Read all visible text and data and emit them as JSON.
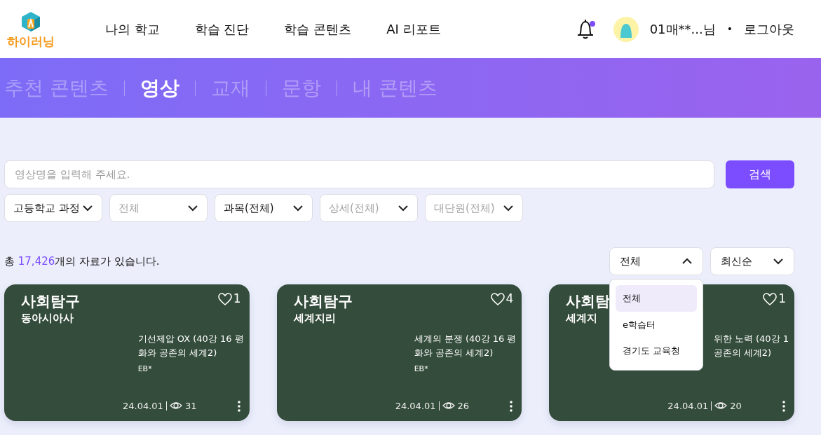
{
  "header": {
    "logo_text": "하이러닝",
    "nav": [
      "나의 학교",
      "학습 진단",
      "학습 콘텐츠",
      "AI 리포트"
    ],
    "has_notification": true,
    "user_name": "01매**...님",
    "user_separator": "•",
    "logout": "로그아웃"
  },
  "content_tabs": [
    {
      "label": "추천 콘텐츠",
      "selected": false
    },
    {
      "label": "영상",
      "selected": true
    },
    {
      "label": "교재",
      "selected": false
    },
    {
      "label": "문항",
      "selected": false
    },
    {
      "label": "내 콘텐츠",
      "selected": false
    }
  ],
  "search": {
    "placeholder": "영상명을 입력해 주세요.",
    "button": "검색"
  },
  "filters": [
    {
      "label": "고등학교 과정",
      "disabled": false
    },
    {
      "label": "전체",
      "disabled": true
    },
    {
      "label": "과목(전체)",
      "disabled": false
    },
    {
      "label": "상세(전체)",
      "disabled": true
    },
    {
      "label": "대단원(전체)",
      "disabled": true
    }
  ],
  "result": {
    "prefix": "총",
    "count": "17,426",
    "suffix": "개의 자료가 있습니다."
  },
  "sort_selects": [
    {
      "label": "전체",
      "expanded": true,
      "options": [
        {
          "label": "전체",
          "selected": true
        },
        {
          "label": "e학습터",
          "selected": false
        },
        {
          "label": "경기도 교육청",
          "selected": false
        }
      ]
    },
    {
      "label": "최신순",
      "expanded": false
    }
  ],
  "cards": [
    {
      "category": "사회탐구",
      "subject": "동아시아사",
      "likes": "1",
      "title_lines": [
        "기선제압 OX (40강 16 평",
        "화와 공존의 세계2)"
      ],
      "provider": "EB*",
      "date": "24.04.01",
      "views": "31"
    },
    {
      "category": "사회탐구",
      "subject": "세계지리",
      "likes": "4",
      "title_lines": [
        "세계의 분쟁 (40강 16 평",
        "화와 공존의 세계2)"
      ],
      "provider": "EB*",
      "date": "24.04.01",
      "views": "26"
    },
    {
      "category": "사회탐",
      "subject": "세계지",
      "likes": "1",
      "title_lines": [
        "위한 노력 (40강 1",
        "공존의 세계2)"
      ],
      "date": "24.04.01",
      "views": "20"
    }
  ]
}
